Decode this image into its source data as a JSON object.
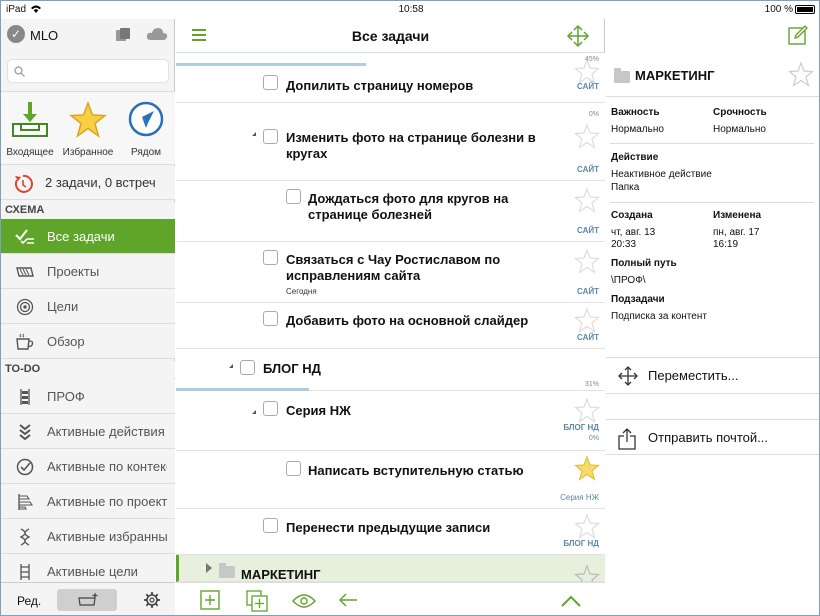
{
  "status": {
    "device": "iPad",
    "time": "10:58",
    "battery": "100 %"
  },
  "sidebar": {
    "app_name": "MLO",
    "search_placeholder": "",
    "quick": [
      {
        "label": "Входящее",
        "icon": "inbox-icon"
      },
      {
        "label": "Избранное",
        "icon": "star-icon"
      },
      {
        "label": "Рядом",
        "icon": "compass-icon"
      }
    ],
    "stats": "2 задачи, 0 встреч",
    "section_scheme": "СХЕМА",
    "scheme_items": [
      {
        "label": "Все задачи",
        "icon": "all-tasks-icon",
        "selected": true
      },
      {
        "label": "Проекты",
        "icon": "projects-icon"
      },
      {
        "label": "Цели",
        "icon": "goals-icon"
      },
      {
        "label": "Обзор",
        "icon": "review-icon"
      }
    ],
    "section_todo": "TO-DO",
    "todo_items": [
      {
        "label": "ПРОФ",
        "icon": "abacus-icon"
      },
      {
        "label": "Активные действия",
        "icon": "chevrons-down-icon"
      },
      {
        "label": "Активные по контексту",
        "icon": "circle-check-icon"
      },
      {
        "label": "Активные по проектам",
        "icon": "project-filter-icon"
      },
      {
        "label": "Активные избранные",
        "icon": "dna-icon"
      },
      {
        "label": "Активные цели",
        "icon": "ladder-icon"
      }
    ],
    "edit_label": "Ред."
  },
  "main": {
    "title": "Все задачи",
    "rows": [
      {
        "title": "Допилить страницу номеров",
        "context": "САЙТ",
        "pct_top": "45%"
      },
      {
        "title": "Изменить фото на странице болезни в кругах",
        "context": "САЙТ",
        "pct_top": "0%"
      },
      {
        "title": "Дождаться фото для кругов на странице болезней",
        "context": "САЙТ"
      },
      {
        "title": "Связаться с Чау Ростиславом по исправлениям сайта",
        "sub": "Сегодня",
        "context": "САЙТ"
      },
      {
        "title": "Добавить фото на основной слайдер",
        "context": "САЙТ"
      },
      {
        "title": "БЛОГ НД",
        "pct": "31%"
      },
      {
        "title": "Серия НЖ",
        "context": "БЛОГ НД",
        "pct": "0%"
      },
      {
        "title": "Написать вступительную статью",
        "context": "Серия НЖ",
        "starred": true
      },
      {
        "title": "Перенести предыдущие записи",
        "context": "БЛОГ НД"
      },
      {
        "title": "МАРКЕТИНГ"
      }
    ],
    "progress": [
      0.45,
      0.31
    ]
  },
  "detail": {
    "title": "МАРКЕТИНГ",
    "importance_label": "Важность",
    "importance": "Нормально",
    "urgency_label": "Срочность",
    "urgency": "Нормально",
    "action_label": "Действие",
    "action_value1": "Неактивное действие",
    "action_value2": "Папка",
    "created_label": "Создана",
    "created_date": "чт, авг. 13",
    "created_time": "20:33",
    "modified_label": "Изменена",
    "modified_date": "пн, авг. 17",
    "modified_time": "16:19",
    "path_label": "Полный путь",
    "path": "\\ПРОФ\\",
    "subtasks_label": "Подзадачи",
    "subtasks": "Подписка за контент",
    "move_label": "Переместить...",
    "mail_label": "Отправить почтой..."
  },
  "colors": {
    "accent": "#5fa52a",
    "context": "#5d86a8",
    "selected_row": "#e6f0dc"
  }
}
